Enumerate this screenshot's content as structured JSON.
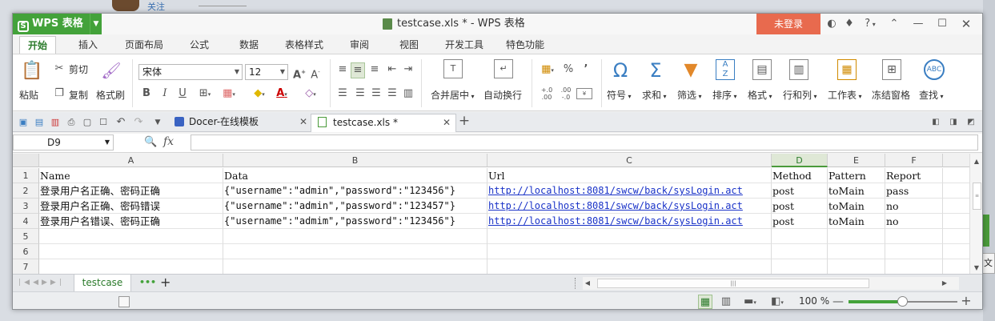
{
  "desktop": {
    "link": "关注"
  },
  "app": {
    "name": "WPS 表格",
    "window_title": "testcase.xls * - WPS 表格",
    "login_label": "未登录",
    "help_label": "?",
    "accent": "#43a23a"
  },
  "menu_tabs": [
    "开始",
    "插入",
    "页面布局",
    "公式",
    "数据",
    "表格样式",
    "审阅",
    "视图",
    "开发工具",
    "特色功能"
  ],
  "ribbon": {
    "paste": "粘贴",
    "cut": "剪切",
    "copy": "复制",
    "format_painter": "格式刷",
    "font_name": "宋体",
    "font_size": "12",
    "merge_center": "合并居中",
    "wrap_text": "自动换行",
    "percent": "%",
    "comma": "’",
    "symbol": "符号",
    "sum": "求和",
    "filter": "筛选",
    "sort": "排序",
    "format": "格式",
    "row_col": "行和列",
    "worksheet": "工作表",
    "freeze": "冻结窗格",
    "find": "查找"
  },
  "doc_tabs": [
    {
      "label": "Docer-在线模板"
    },
    {
      "label": "testcase.xls *"
    }
  ],
  "formula_bar": {
    "cell_ref": "D9",
    "fx": "fx"
  },
  "grid": {
    "columns": [
      "A",
      "B",
      "C",
      "D",
      "E",
      "F"
    ],
    "row_numbers": [
      "1",
      "2",
      "3",
      "4",
      "5",
      "6",
      "7"
    ],
    "rows": [
      [
        "Name",
        "Data",
        "Url",
        "Method",
        "Pattern",
        "Report"
      ],
      [
        "登录用户名正确、密码正确",
        "{\"username\":\"admin\",\"password\":\"123456\"}",
        "http://localhost:8081/swcw/back/sysLogin.act",
        "post",
        "toMain",
        "pass"
      ],
      [
        "登录用户名正确、密码错误",
        "{\"username\":\"admin\",\"password\":\"123457\"}",
        "http://localhost:8081/swcw/back/sysLogin.act",
        "post",
        "toMain",
        "no"
      ],
      [
        "登录用户名错误、密码正确",
        "{\"username\":\"admim\",\"password\":\"123456\"}",
        "http://localhost:8081/swcw/back/sysLogin.act",
        "post",
        "toMain",
        "no"
      ]
    ]
  },
  "sheet": {
    "tab": "testcase",
    "more": "•••",
    "add": "+"
  },
  "status": {
    "zoom": "100 %"
  },
  "desktop_edge": {
    "text": "文"
  }
}
